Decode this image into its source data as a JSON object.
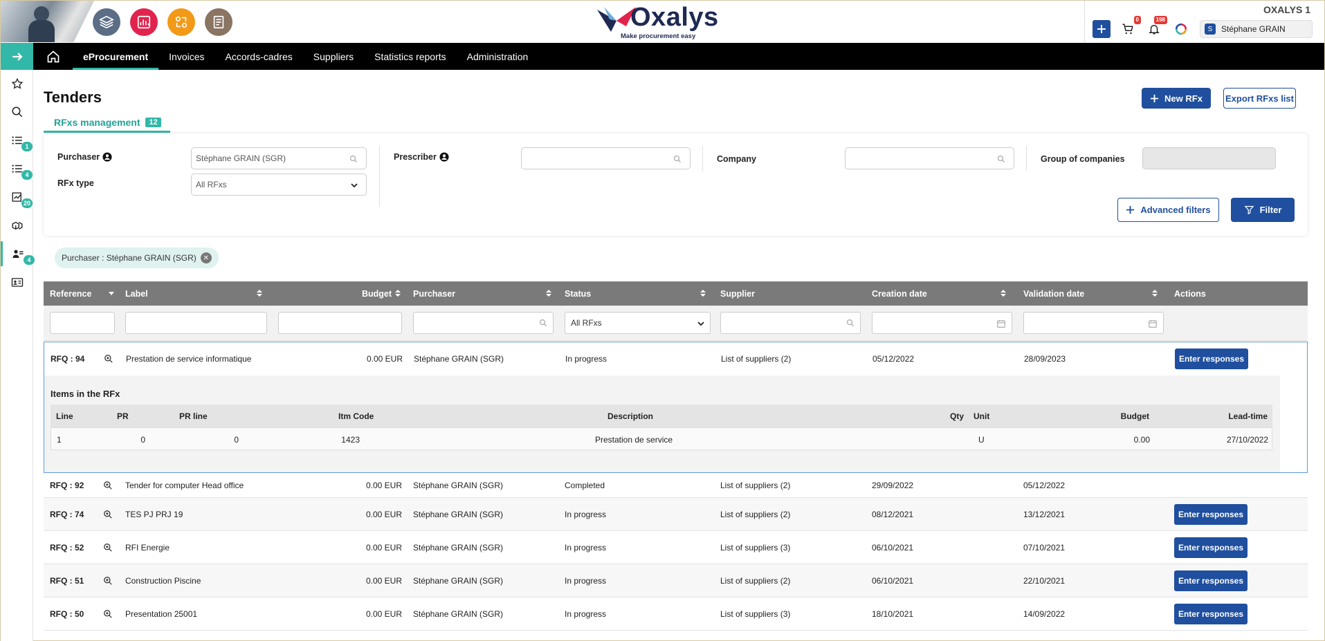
{
  "header": {
    "company": "OXALYS 1",
    "logo_name": "Oxalys",
    "logo_tagline": "Make procurement easy",
    "cart_count": "0",
    "notif_count": "198",
    "user_initial": "S",
    "user_name": "Stéphane GRAIN",
    "module_colors": [
      "#5b6e86",
      "#e0244e",
      "#f29a17",
      "#8a7462"
    ]
  },
  "nav": {
    "items": [
      "eProcurement",
      "Invoices",
      "Accords-cadres",
      "Suppliers",
      "Statistics reports",
      "Administration"
    ],
    "active": "eProcurement"
  },
  "sidebar": {
    "badges": [
      "1",
      "4",
      "20",
      "4"
    ]
  },
  "page": {
    "title": "Tenders",
    "tab_label": "RFxs management",
    "tab_count": "12",
    "new_rfx": "New RFx",
    "export": "Export RFxs list"
  },
  "filters": {
    "purchaser_label": "Purchaser",
    "purchaser_value": "Stéphane GRAIN (SGR)",
    "prescriber_label": "Prescriber",
    "company_label": "Company",
    "group_label": "Group of companies",
    "rfx_type_label": "RFx type",
    "rfx_type_value": "All RFxs",
    "advanced": "Advanced filters",
    "filter": "Filter",
    "chip": "Purchaser : Stéphane GRAIN (SGR)"
  },
  "table": {
    "columns": [
      "Reference",
      "Label",
      "Budget",
      "Purchaser",
      "Status",
      "Supplier",
      "Creation date",
      "Validation date",
      "Actions"
    ],
    "status_filter": "All RFxs",
    "action_label": "Enter responses",
    "rows": [
      {
        "ref": "RFQ : 94",
        "label": "Prestation de service informatique",
        "budget": "0.00 EUR",
        "purchaser": "Stéphane GRAIN (SGR)",
        "status": "In progress",
        "supplier": "List of suppliers (2)",
        "created": "05/12/2022",
        "validated": "28/09/2023",
        "action": true
      },
      {
        "ref": "RFQ : 92",
        "label": "Tender for computer Head office",
        "budget": "0.00 EUR",
        "purchaser": "Stéphane GRAIN (SGR)",
        "status": "Completed",
        "supplier": "List of suppliers (2)",
        "created": "29/09/2022",
        "validated": "05/12/2022",
        "action": false
      },
      {
        "ref": "RFQ : 74",
        "label": "TES PJ PRJ 19",
        "budget": "0.00 EUR",
        "purchaser": "Stéphane GRAIN (SGR)",
        "status": "In progress",
        "supplier": "List of suppliers (2)",
        "created": "08/12/2021",
        "validated": "13/12/2021",
        "action": true
      },
      {
        "ref": "RFQ : 52",
        "label": "RFI Energie",
        "budget": "0.00 EUR",
        "purchaser": "Stéphane GRAIN (SGR)",
        "status": "In progress",
        "supplier": "List of suppliers (3)",
        "created": "06/10/2021",
        "validated": "07/10/2021",
        "action": true
      },
      {
        "ref": "RFQ : 51",
        "label": "Construction Piscine",
        "budget": "0.00 EUR",
        "purchaser": "Stéphane GRAIN (SGR)",
        "status": "In progress",
        "supplier": "List of suppliers (2)",
        "created": "06/10/2021",
        "validated": "22/10/2021",
        "action": true
      },
      {
        "ref": "RFQ : 50",
        "label": "Presentation 25001",
        "budget": "0.00 EUR",
        "purchaser": "Stéphane GRAIN (SGR)",
        "status": "In progress",
        "supplier": "List of suppliers (3)",
        "created": "18/10/2021",
        "validated": "14/09/2022",
        "action": true
      }
    ],
    "items_title": "Items in the RFx",
    "item_columns": [
      "Line",
      "PR",
      "PR line",
      "Itm Code",
      "Description",
      "Qty",
      "Unit",
      "Budget",
      "Lead-time"
    ],
    "item_row": {
      "line": "1",
      "pr": "0",
      "pr_line": "0",
      "code": "1423",
      "desc": "Prestation de service",
      "qty": "",
      "unit": "U",
      "budget": "0.00",
      "lead": "27/10/2022"
    }
  }
}
